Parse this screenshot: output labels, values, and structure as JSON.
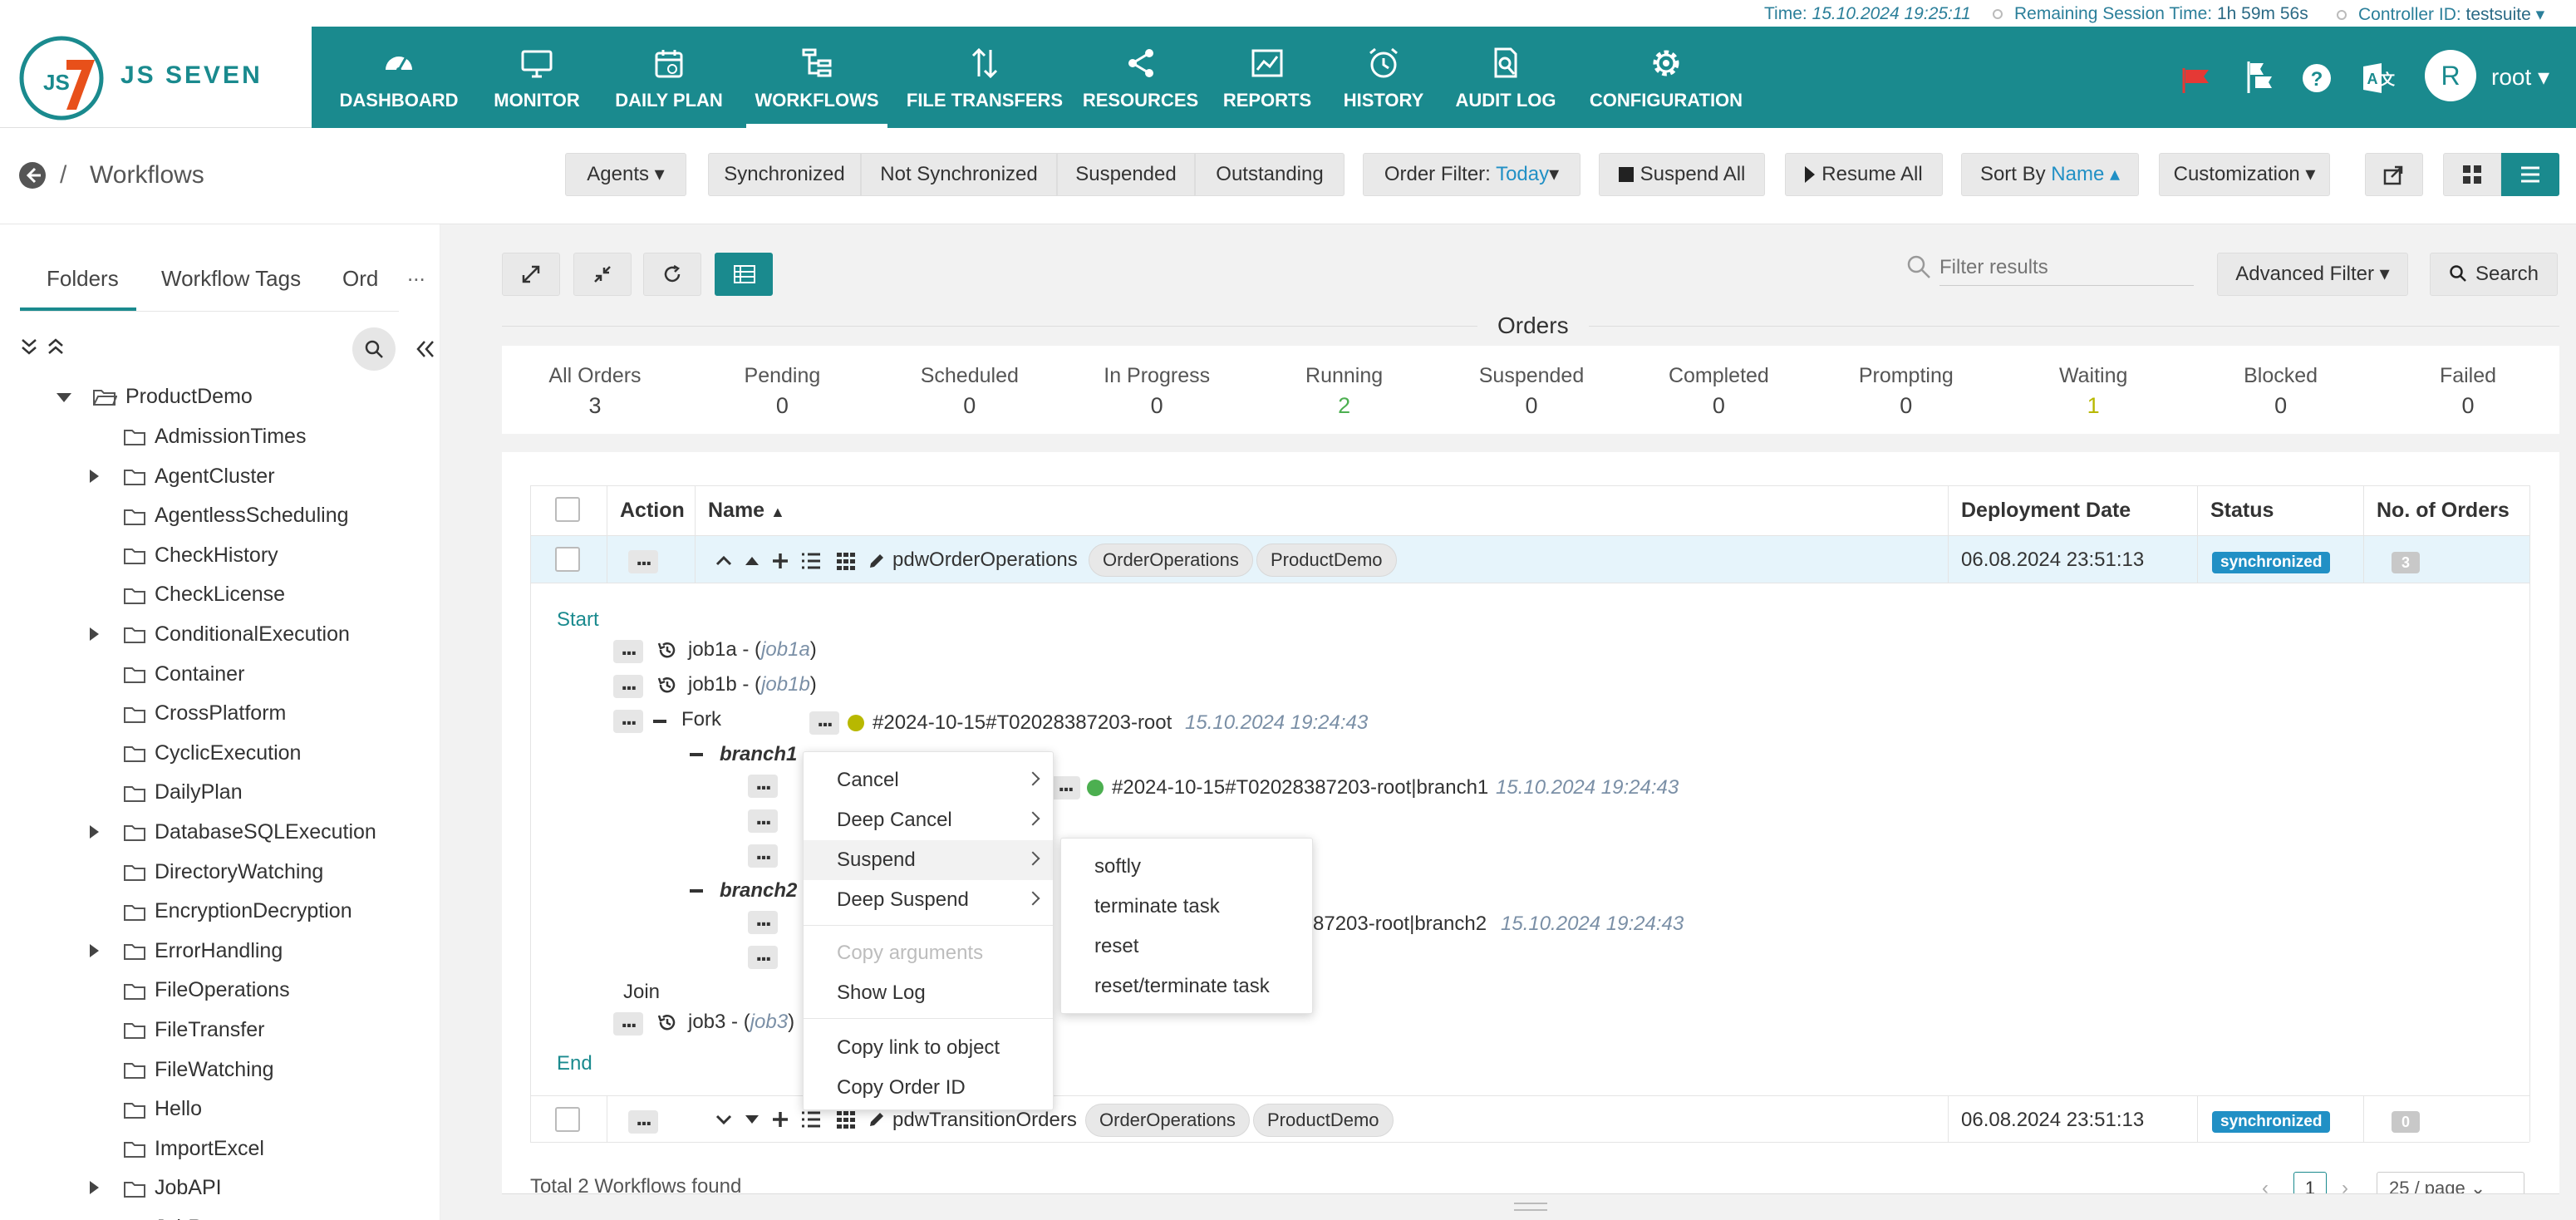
{
  "top_strip": {
    "time_label": "Time: ",
    "time_value": "15.10.2024 19:25:11",
    "session_label": "Remaining Session Time: ",
    "session_value": "1h 59m 56s",
    "controller_label": "Controller ID: ",
    "controller_value": "testsuite"
  },
  "brand": {
    "name": "JS SEVEN",
    "mark": "JS7"
  },
  "nav": {
    "items": [
      {
        "label": "DASHBOARD",
        "icon": "dashboard-icon"
      },
      {
        "label": "MONITOR",
        "icon": "monitor-icon"
      },
      {
        "label": "DAILY PLAN",
        "icon": "calendar-icon"
      },
      {
        "label": "WORKFLOWS",
        "icon": "workflow-icon"
      },
      {
        "label": "FILE TRANSFERS",
        "icon": "transfer-icon"
      },
      {
        "label": "RESOURCES",
        "icon": "share-icon"
      },
      {
        "label": "REPORTS",
        "icon": "chart-icon"
      },
      {
        "label": "HISTORY",
        "icon": "alarm-clock-icon"
      },
      {
        "label": "AUDIT LOG",
        "icon": "document-search-icon"
      },
      {
        "label": "CONFIGURATION",
        "icon": "gear-icon"
      }
    ],
    "user_initial": "R",
    "user_name": "root"
  },
  "subheader": {
    "breadcrumb_sep": "/",
    "title": "Workflows",
    "agents": "Agents",
    "synchronized": "Synchronized",
    "not_synchronized": "Not Synchronized",
    "suspended": "Suspended",
    "outstanding": "Outstanding",
    "order_filter_label": "Order Filter: ",
    "order_filter_value": "Today",
    "suspend_all": "Suspend All",
    "resume_all": "Resume All",
    "sort_by_label": "Sort By ",
    "sort_by_value": "Name",
    "customization": "Customization"
  },
  "left_panel": {
    "tabs": [
      "Folders",
      "Workflow Tags",
      "Ord"
    ],
    "more": "...",
    "root_folder": "ProductDemo",
    "folders": [
      {
        "name": "AdmissionTimes",
        "expandable": false
      },
      {
        "name": "AgentCluster",
        "expandable": true
      },
      {
        "name": "AgentlessScheduling",
        "expandable": false
      },
      {
        "name": "CheckHistory",
        "expandable": false
      },
      {
        "name": "CheckLicense",
        "expandable": false
      },
      {
        "name": "ConditionalExecution",
        "expandable": true
      },
      {
        "name": "Container",
        "expandable": false
      },
      {
        "name": "CrossPlatform",
        "expandable": false
      },
      {
        "name": "CyclicExecution",
        "expandable": false
      },
      {
        "name": "DailyPlan",
        "expandable": false
      },
      {
        "name": "DatabaseSQLExecution",
        "expandable": true
      },
      {
        "name": "DirectoryWatching",
        "expandable": false
      },
      {
        "name": "EncryptionDecryption",
        "expandable": false
      },
      {
        "name": "ErrorHandling",
        "expandable": true
      },
      {
        "name": "FileOperations",
        "expandable": false
      },
      {
        "name": "FileTransfer",
        "expandable": false
      },
      {
        "name": "FileWatching",
        "expandable": false
      },
      {
        "name": "Hello",
        "expandable": false
      },
      {
        "name": "ImportExcel",
        "expandable": false
      },
      {
        "name": "JobAPI",
        "expandable": true
      },
      {
        "name": "JobRe",
        "expandable": false
      }
    ]
  },
  "search": {
    "placeholder": "Filter results",
    "advanced_filter": "Advanced Filter",
    "search": "Search"
  },
  "orders": {
    "title": "Orders",
    "stats": [
      {
        "label": "All Orders",
        "value": "3"
      },
      {
        "label": "Pending",
        "value": "0"
      },
      {
        "label": "Scheduled",
        "value": "0"
      },
      {
        "label": "In Progress",
        "value": "0"
      },
      {
        "label": "Running",
        "value": "2"
      },
      {
        "label": "Suspended",
        "value": "0"
      },
      {
        "label": "Completed",
        "value": "0"
      },
      {
        "label": "Prompting",
        "value": "0"
      },
      {
        "label": "Waiting",
        "value": "1"
      },
      {
        "label": "Blocked",
        "value": "0"
      },
      {
        "label": "Failed",
        "value": "0"
      }
    ],
    "colors": {
      "running": "#4caf50",
      "waiting": "#b8b800"
    }
  },
  "table": {
    "headers": {
      "action": "Action",
      "name": "Name",
      "deployment_date": "Deployment Date",
      "status": "Status",
      "orders": "No. of Orders"
    },
    "rows": [
      {
        "name": "pdwOrderOperations",
        "tags": [
          "OrderOperations",
          "ProductDemo"
        ],
        "deployment_date": "06.08.2024 23:51:13",
        "status": "synchronized",
        "orders": "3"
      },
      {
        "name": "pdwTransitionOrders",
        "tags": [
          "OrderOperations",
          "ProductDemo"
        ],
        "deployment_date": "06.08.2024 23:51:13",
        "status": "synchronized",
        "orders": "0"
      }
    ],
    "footer": "Total 2 Workflows found",
    "page": "1",
    "page_size": "25 / page"
  },
  "workflow": {
    "start": "Start",
    "end": "End",
    "job1a": {
      "label": "job1a -",
      "name": "job1a"
    },
    "job1b": {
      "label": "job1b -",
      "name": "job1b"
    },
    "fork": "Fork",
    "fork_order": {
      "id": "#2024-10-15#T02028387203-root",
      "time": "15.10.2024 19:24:43"
    },
    "branch1": "branch1",
    "branch1_order": {
      "id": "#2024-10-15#T02028387203-root|branch1",
      "time": "15.10.2024 19:24:43"
    },
    "branch2": "branch2",
    "branch2_order": {
      "id": "87203-root|branch2",
      "time": "15.10.2024 19:24:43"
    },
    "join": "Join",
    "job3": {
      "label": "job3 -",
      "name": "job3"
    }
  },
  "context_menu": {
    "items": [
      "Cancel",
      "Deep Cancel",
      "Suspend",
      "Deep Suspend",
      "Copy arguments",
      "Show Log",
      "Copy link to object",
      "Copy Order ID"
    ],
    "submenu": [
      "softly",
      "terminate task",
      "reset",
      "reset/terminate task"
    ]
  }
}
